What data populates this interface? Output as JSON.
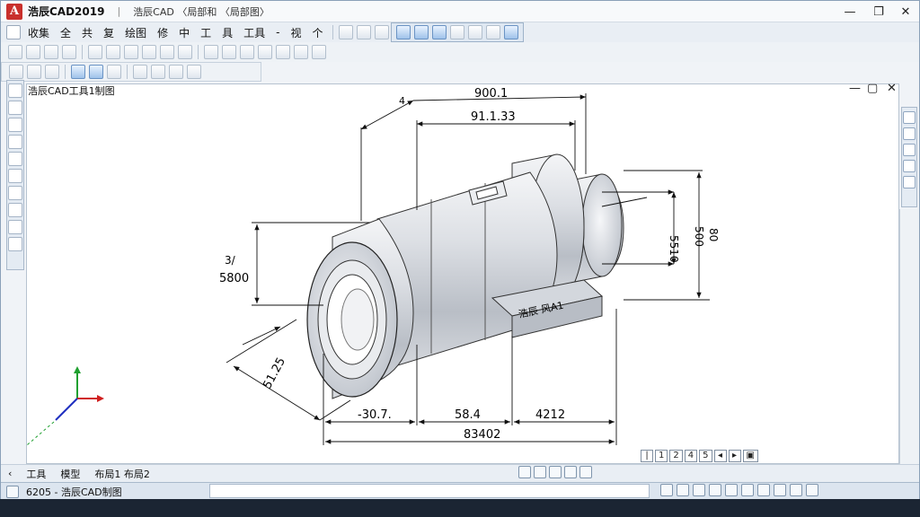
{
  "window": {
    "app_title": "浩辰CAD2019",
    "title_tail": "浩辰CAD  〈局部和  〈局部图〉",
    "minimize": "—",
    "restore": "❐",
    "close": "✕"
  },
  "menu": {
    "items": [
      "收集",
      "全",
      "共",
      "复",
      "绘图",
      "修",
      "中",
      "工",
      "具",
      "工具",
      "-",
      "视",
      "个"
    ]
  },
  "document": {
    "title": "浩辰CAD工具1制图",
    "min": "—",
    "restore": "▢",
    "close": "✕"
  },
  "dimensions": {
    "top_overall": "900.1",
    "top_inner": "91.1.33",
    "left_height_a": "3/",
    "left_height_b": "5800",
    "left_diameter": "51.25",
    "right_a": "5510",
    "right_b": "500",
    "right_c": "80",
    "bottom_left": "-30.7.",
    "bottom_mid": "58.4",
    "bottom_right": "4212",
    "bottom_total": "83402",
    "label_plate": "浩辰 风A1"
  },
  "layout_nav": {
    "items": [
      "1",
      "2",
      "4",
      "5"
    ]
  },
  "tabs": {
    "items": [
      "工具",
      "模型",
      "布局1 布局2"
    ]
  },
  "status": {
    "text": "6205 - 浩辰CAD制图"
  },
  "colors": {
    "accent": "#c9302c",
    "ucs_x": "#d02020",
    "ucs_y": "#20a030",
    "ucs_z": "#2030c0"
  }
}
